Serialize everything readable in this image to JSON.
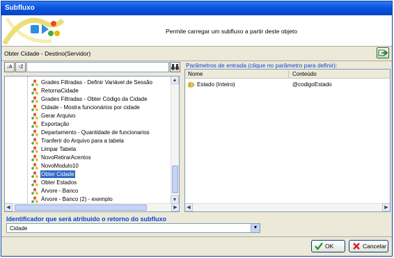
{
  "window": {
    "title": "Subfluxo"
  },
  "banner": {
    "description": "Permite carregar um subfluxo a partir deste objeto"
  },
  "context": {
    "label": "Obter Cidade - Destino(Servidor)"
  },
  "left": {
    "search_value": "",
    "items": [
      {
        "label": "Grades Filtradas - Definir Variável de Sessão"
      },
      {
        "label": "RetornaCidade"
      },
      {
        "label": "Grades Filtradas - Obter Código da Cidade"
      },
      {
        "label": "Cidade - Mostra funcionários por cidade"
      },
      {
        "label": "Gerar Arquivo"
      },
      {
        "label": "Exportação"
      },
      {
        "label": "Departamento - Quantidade de funcionarios"
      },
      {
        "label": "Tranferir do Arquivo para a tabela"
      },
      {
        "label": "Limpar Tabela"
      },
      {
        "label": "NovoRetirarAcentos"
      },
      {
        "label": "NovoModulo10"
      },
      {
        "label": "Obter Cidade",
        "selected": true
      },
      {
        "label": "Obter Estados"
      },
      {
        "label": "Árvore - Banco"
      },
      {
        "label": "Árvore - Banco (2) - exemplo"
      }
    ]
  },
  "right": {
    "label": "Parâmetros de entrada (clique no parâmetro para definir):",
    "columns": [
      "Nome",
      "Conteúdo"
    ],
    "rows": [
      {
        "nome": "Estado (Inteiro)",
        "conteudo": "@codigoEstado"
      }
    ]
  },
  "bottom": {
    "label": "Identificador que será atribuido o retorno do subfluxo",
    "selected_value": "Cidade"
  },
  "buttons": {
    "ok": "OK",
    "cancel": "Cancelar"
  },
  "colors": {
    "title_blue": "#0a55e0",
    "accent_label": "#0a46d3",
    "selection": "#316ac5"
  }
}
